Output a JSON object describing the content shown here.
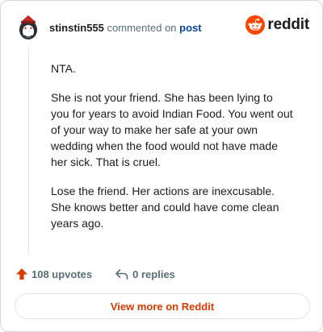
{
  "header": {
    "username": "stinstin555",
    "commented_on": "commented on",
    "post_link": "post",
    "brand_word": "reddit",
    "avatar_icon": "snoo-avatar-icon",
    "brand_icon": "reddit-logo-icon",
    "brand_color": "#ff4500"
  },
  "comment": {
    "paragraphs": [
      "NTA.",
      "She is not your friend. She has been lying to you for years to avoid Indian Food. You went out of your way to make her safe at your own wedding when the food would not have made her sick. That is cruel.",
      "Lose the friend. Her actions are inexcusable. She knows better and could have come clean years ago."
    ]
  },
  "actions": {
    "upvotes": "108 upvotes",
    "replies": "0 replies",
    "upvote_icon": "upvote-arrow-icon",
    "reply_icon": "reply-arrow-icon",
    "upvote_color": "#d93a00"
  },
  "footer": {
    "view_more": "View more on Reddit",
    "accent_color": "#d93a00"
  }
}
